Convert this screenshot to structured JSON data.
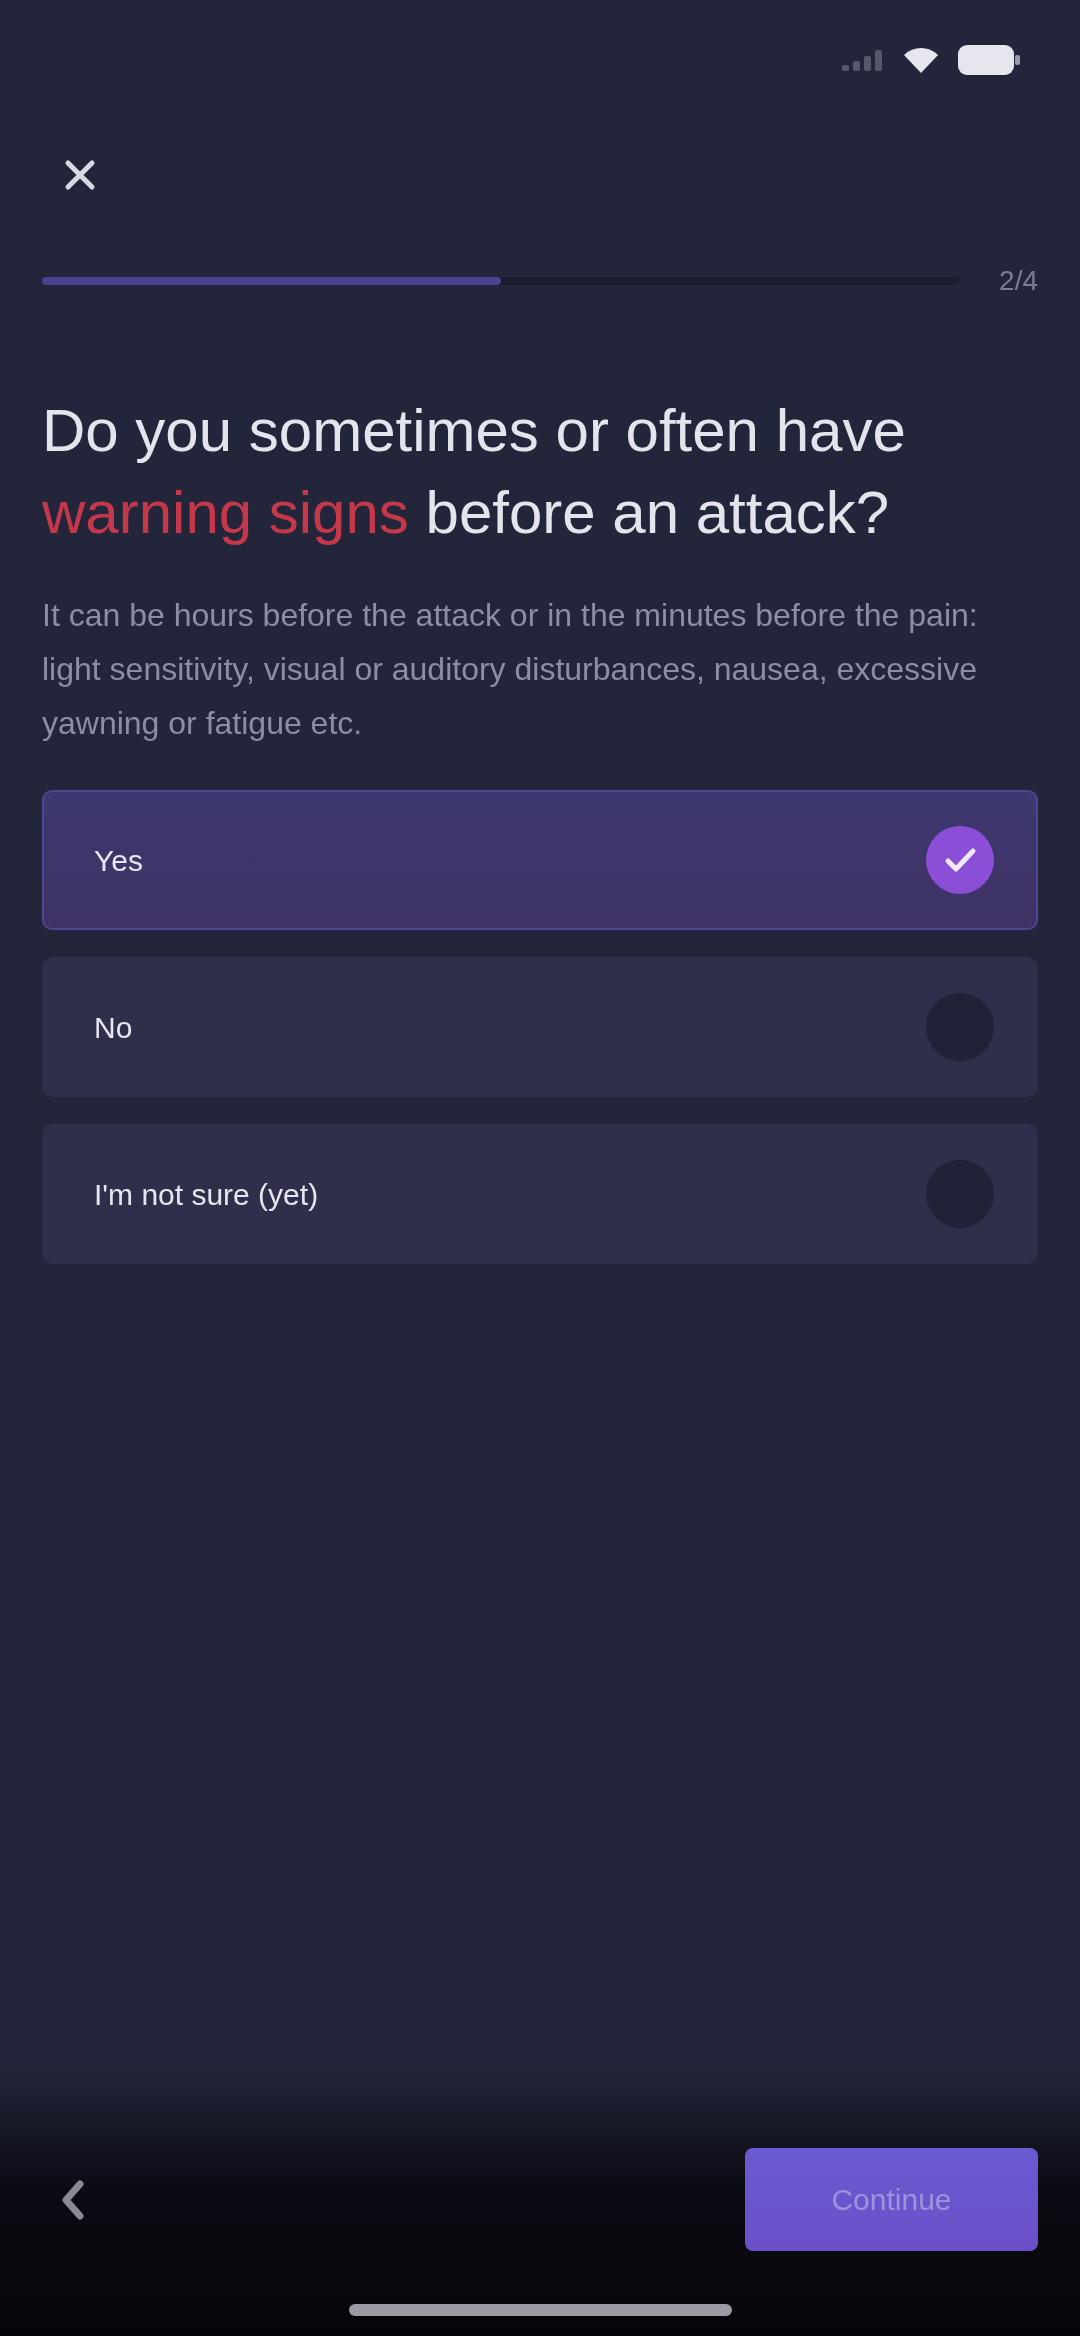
{
  "progress": {
    "level": 0.5,
    "label": "2/4"
  },
  "question": {
    "title": [
      {
        "text": "Do you sometimes or often have ",
        "highlight": false
      },
      {
        "text": "warning signs",
        "highlight": true
      },
      {
        "text": " before an attack?",
        "highlight": false
      }
    ],
    "description": "It can be hours before the attack or in the minutes before the pain: light sensitivity, visual or auditory disturbances, nausea, excessive yawning or fatigue etc."
  },
  "options": [
    {
      "label": "Yes",
      "selected": true
    },
    {
      "label": "No",
      "selected": false
    },
    {
      "label": "I'm not sure (yet)",
      "selected": false
    }
  ],
  "footer": {
    "button": "Continue"
  }
}
